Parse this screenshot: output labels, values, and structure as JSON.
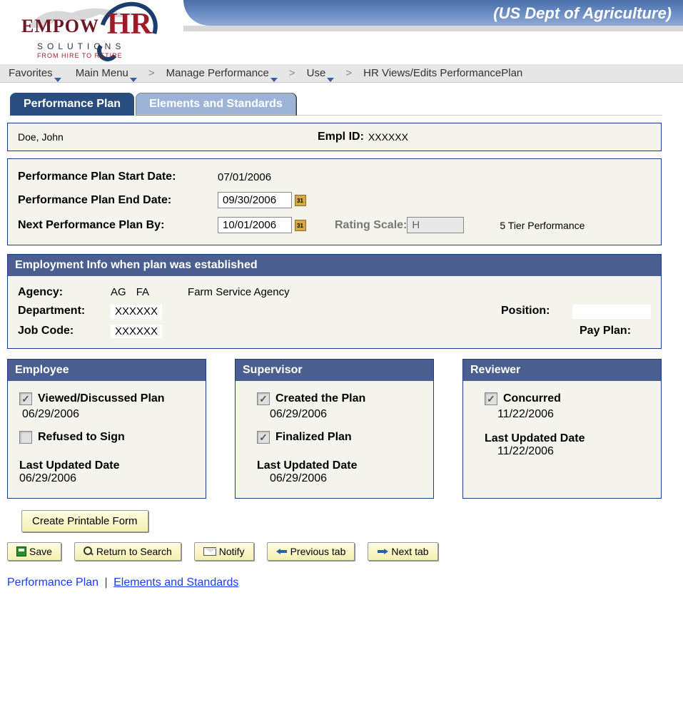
{
  "header": {
    "org": "(US Dept of Agriculture)",
    "logo_main": "EMPOW",
    "logo_hr": "HR",
    "logo_sub1": "SOLUTIONS",
    "logo_sub2": "FROM HIRE TO RETIRE"
  },
  "breadcrumb": {
    "items": [
      "Favorites",
      "Main Menu",
      "Manage Performance",
      "Use",
      "HR Views/Edits PerformancePlan"
    ]
  },
  "tabs": {
    "active": "Performance Plan",
    "inactive": "Elements and Standards"
  },
  "employee": {
    "name": "Doe, John",
    "empl_id_label": "Empl ID:",
    "empl_id": "XXXXXX"
  },
  "plan": {
    "start_label": "Performance Plan Start Date:",
    "start_value": "07/01/2006",
    "end_label": "Performance Plan End Date:",
    "end_value": "09/30/2006",
    "next_label": "Next Performance Plan By:",
    "next_value": "10/01/2006",
    "rating_label": "Rating Scale:",
    "rating_value": "H",
    "rating_desc": "5 Tier Performance"
  },
  "emp_info": {
    "header": "Employment Info when plan was established",
    "agency_label": "Agency:",
    "agency_code1": "AG",
    "agency_code2": "FA",
    "agency_name": "Farm Service Agency",
    "dept_label": "Department:",
    "dept_value": "XXXXXX",
    "jobcode_label": "Job Code:",
    "jobcode_value": "XXXXXX",
    "position_label": "Position:",
    "position_value": "",
    "payplan_label": "Pay Plan:",
    "payplan_value": ""
  },
  "col_employee": {
    "header": "Employee",
    "viewed_label": "Viewed/Discussed Plan",
    "viewed_checked": true,
    "viewed_date": "06/29/2006",
    "refused_label": "Refused to Sign",
    "refused_checked": false,
    "last_upd_label": "Last Updated Date",
    "last_upd_value": "06/29/2006"
  },
  "col_supervisor": {
    "header": "Supervisor",
    "created_label": "Created the Plan",
    "created_checked": true,
    "created_date": "06/29/2006",
    "finalized_label": "Finalized Plan",
    "finalized_checked": true,
    "last_upd_label": "Last Updated Date",
    "last_upd_value": "06/29/2006"
  },
  "col_reviewer": {
    "header": "Reviewer",
    "concurred_label": "Concurred",
    "concurred_checked": true,
    "concurred_date": "11/22/2006",
    "last_upd_label": "Last Updated Date",
    "last_upd_value": "11/22/2006"
  },
  "buttons": {
    "create_printable": "Create Printable Form",
    "save": "Save",
    "return": "Return to Search",
    "notify": "Notify",
    "prev": "Previous tab",
    "next": "Next tab"
  },
  "footer": {
    "link1": "Performance Plan",
    "link2": "Elements and Standards"
  }
}
